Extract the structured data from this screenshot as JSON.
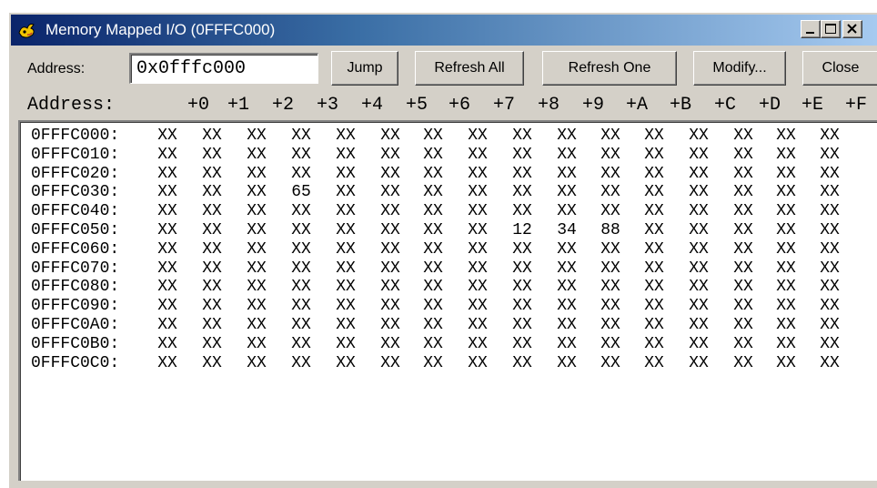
{
  "window": {
    "title": "Memory Mapped I/O (0FFFC000)"
  },
  "toolbar": {
    "address_label": "Address:",
    "address_value": "0x0fffc000",
    "jump": "Jump",
    "refresh_all": "Refresh All",
    "refresh_one": "Refresh One",
    "modify": "Modify...",
    "close": "Close"
  },
  "header": {
    "label": "Address:",
    "offsets": [
      "+0",
      "+1",
      "+2",
      "+3",
      "+4",
      "+5",
      "+6",
      "+7",
      "+8",
      "+9",
      "+A",
      "+B",
      "+C",
      "+D",
      "+E",
      "+F"
    ]
  },
  "rows": [
    {
      "address": "0FFFC000:",
      "cells": [
        "XX",
        "XX",
        "XX",
        "XX",
        "XX",
        "XX",
        "XX",
        "XX",
        "XX",
        "XX",
        "XX",
        "XX",
        "XX",
        "XX",
        "XX",
        "XX"
      ]
    },
    {
      "address": "0FFFC010:",
      "cells": [
        "XX",
        "XX",
        "XX",
        "XX",
        "XX",
        "XX",
        "XX",
        "XX",
        "XX",
        "XX",
        "XX",
        "XX",
        "XX",
        "XX",
        "XX",
        "XX"
      ]
    },
    {
      "address": "0FFFC020:",
      "cells": [
        "XX",
        "XX",
        "XX",
        "XX",
        "XX",
        "XX",
        "XX",
        "XX",
        "XX",
        "XX",
        "XX",
        "XX",
        "XX",
        "XX",
        "XX",
        "XX"
      ]
    },
    {
      "address": "0FFFC030:",
      "cells": [
        "XX",
        "XX",
        "XX",
        "65",
        "XX",
        "XX",
        "XX",
        "XX",
        "XX",
        "XX",
        "XX",
        "XX",
        "XX",
        "XX",
        "XX",
        "XX"
      ]
    },
    {
      "address": "0FFFC040:",
      "cells": [
        "XX",
        "XX",
        "XX",
        "XX",
        "XX",
        "XX",
        "XX",
        "XX",
        "XX",
        "XX",
        "XX",
        "XX",
        "XX",
        "XX",
        "XX",
        "XX"
      ]
    },
    {
      "address": "0FFFC050:",
      "cells": [
        "XX",
        "XX",
        "XX",
        "XX",
        "XX",
        "XX",
        "XX",
        "XX",
        "12",
        "34",
        "88",
        "XX",
        "XX",
        "XX",
        "XX",
        "XX"
      ]
    },
    {
      "address": "0FFFC060:",
      "cells": [
        "XX",
        "XX",
        "XX",
        "XX",
        "XX",
        "XX",
        "XX",
        "XX",
        "XX",
        "XX",
        "XX",
        "XX",
        "XX",
        "XX",
        "XX",
        "XX"
      ]
    },
    {
      "address": "0FFFC070:",
      "cells": [
        "XX",
        "XX",
        "XX",
        "XX",
        "XX",
        "XX",
        "XX",
        "XX",
        "XX",
        "XX",
        "XX",
        "XX",
        "XX",
        "XX",
        "XX",
        "XX"
      ]
    },
    {
      "address": "0FFFC080:",
      "cells": [
        "XX",
        "XX",
        "XX",
        "XX",
        "XX",
        "XX",
        "XX",
        "XX",
        "XX",
        "XX",
        "XX",
        "XX",
        "XX",
        "XX",
        "XX",
        "XX"
      ]
    },
    {
      "address": "0FFFC090:",
      "cells": [
        "XX",
        "XX",
        "XX",
        "XX",
        "XX",
        "XX",
        "XX",
        "XX",
        "XX",
        "XX",
        "XX",
        "XX",
        "XX",
        "XX",
        "XX",
        "XX"
      ]
    },
    {
      "address": "0FFFC0A0:",
      "cells": [
        "XX",
        "XX",
        "XX",
        "XX",
        "XX",
        "XX",
        "XX",
        "XX",
        "XX",
        "XX",
        "XX",
        "XX",
        "XX",
        "XX",
        "XX",
        "XX"
      ]
    },
    {
      "address": "0FFFC0B0:",
      "cells": [
        "XX",
        "XX",
        "XX",
        "XX",
        "XX",
        "XX",
        "XX",
        "XX",
        "XX",
        "XX",
        "XX",
        "XX",
        "XX",
        "XX",
        "XX",
        "XX"
      ]
    },
    {
      "address": "0FFFC0C0:",
      "cells": [
        "XX",
        "XX",
        "XX",
        "XX",
        "XX",
        "XX",
        "XX",
        "XX",
        "XX",
        "XX",
        "XX",
        "XX",
        "XX",
        "XX",
        "XX",
        "XX"
      ]
    }
  ],
  "icons": {
    "app": "app-icon",
    "minimize": "minimize-icon",
    "maximize": "maximize-icon",
    "close": "close-icon"
  },
  "colors": {
    "titlebar_start": "#0a246a",
    "titlebar_end": "#a6caf0",
    "face": "#d4d0c8"
  }
}
